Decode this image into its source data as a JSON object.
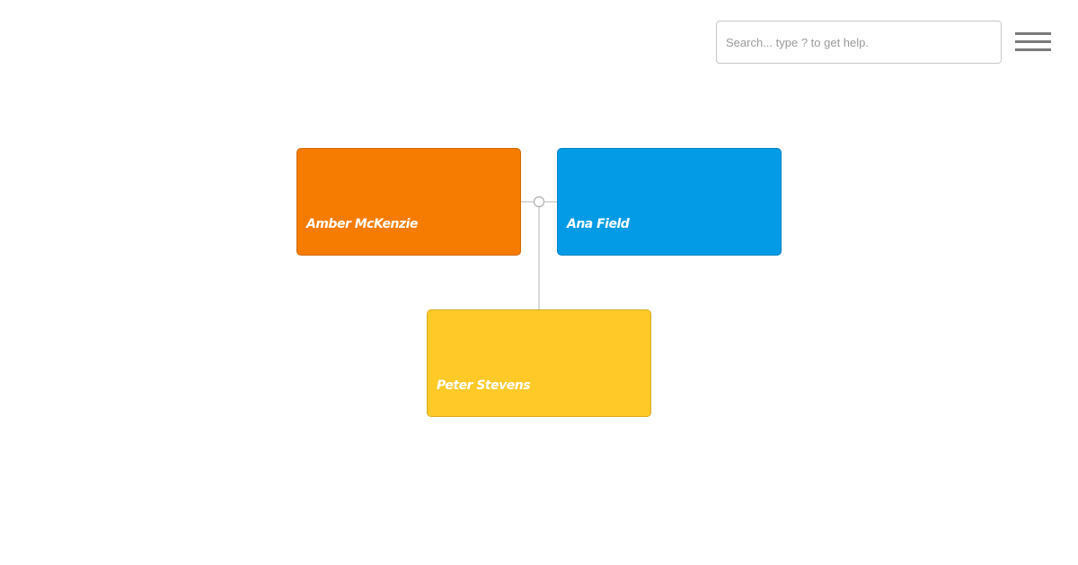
{
  "search": {
    "placeholder": "Search... type ? to get help."
  },
  "menu": {
    "icon": "hamburger-menu-icon"
  },
  "family_tree": {
    "nodes": [
      {
        "id": "amber",
        "name": "Amber McKenzie",
        "color": "#f57c00"
      },
      {
        "id": "ana",
        "name": "Ana Field",
        "color": "#039be5"
      },
      {
        "id": "peter",
        "name": "Peter Stevens",
        "color": "#ffca28"
      }
    ],
    "connector_color": "#c0c0c0"
  }
}
